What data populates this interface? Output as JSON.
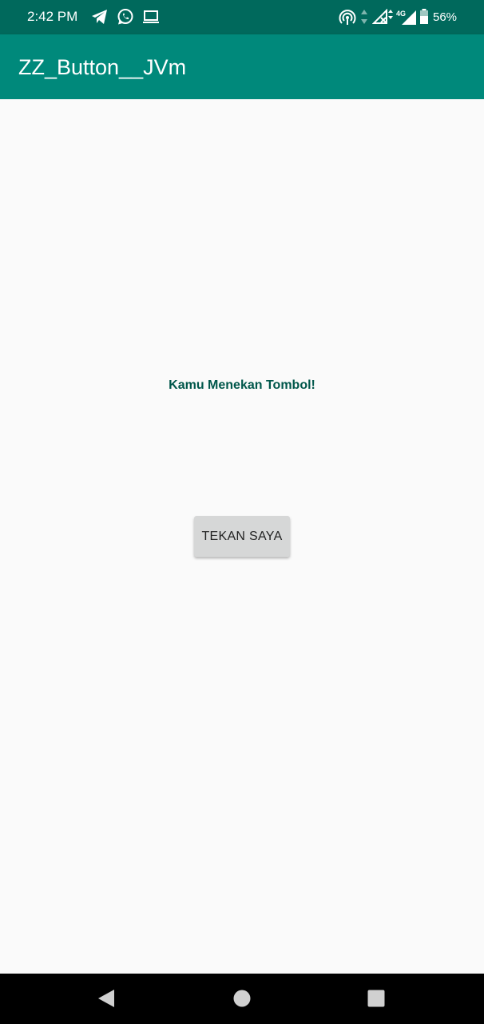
{
  "status_bar": {
    "time": "2:42 PM",
    "battery_percent": "56%",
    "left_icons": [
      "telegram-icon",
      "whatsapp-icon",
      "laptop-icon"
    ],
    "right_icons": [
      "hotspot-icon",
      "data-arrows-icon",
      "signal-no-service-icon",
      "4g-icon",
      "signal-icon",
      "battery-icon"
    ]
  },
  "app_bar": {
    "title": "ZZ_Button__JVm"
  },
  "main": {
    "message": "Kamu Menekan Tombol!",
    "button_label": "TEKAN SAYA"
  },
  "nav_bar": {
    "buttons": [
      "back-icon",
      "home-icon",
      "recents-icon"
    ]
  },
  "colors": {
    "status_bar": "#00695c",
    "app_bar": "#00897b",
    "message_text": "#00574b",
    "background": "#fafafa",
    "button": "#d6d7d7"
  }
}
